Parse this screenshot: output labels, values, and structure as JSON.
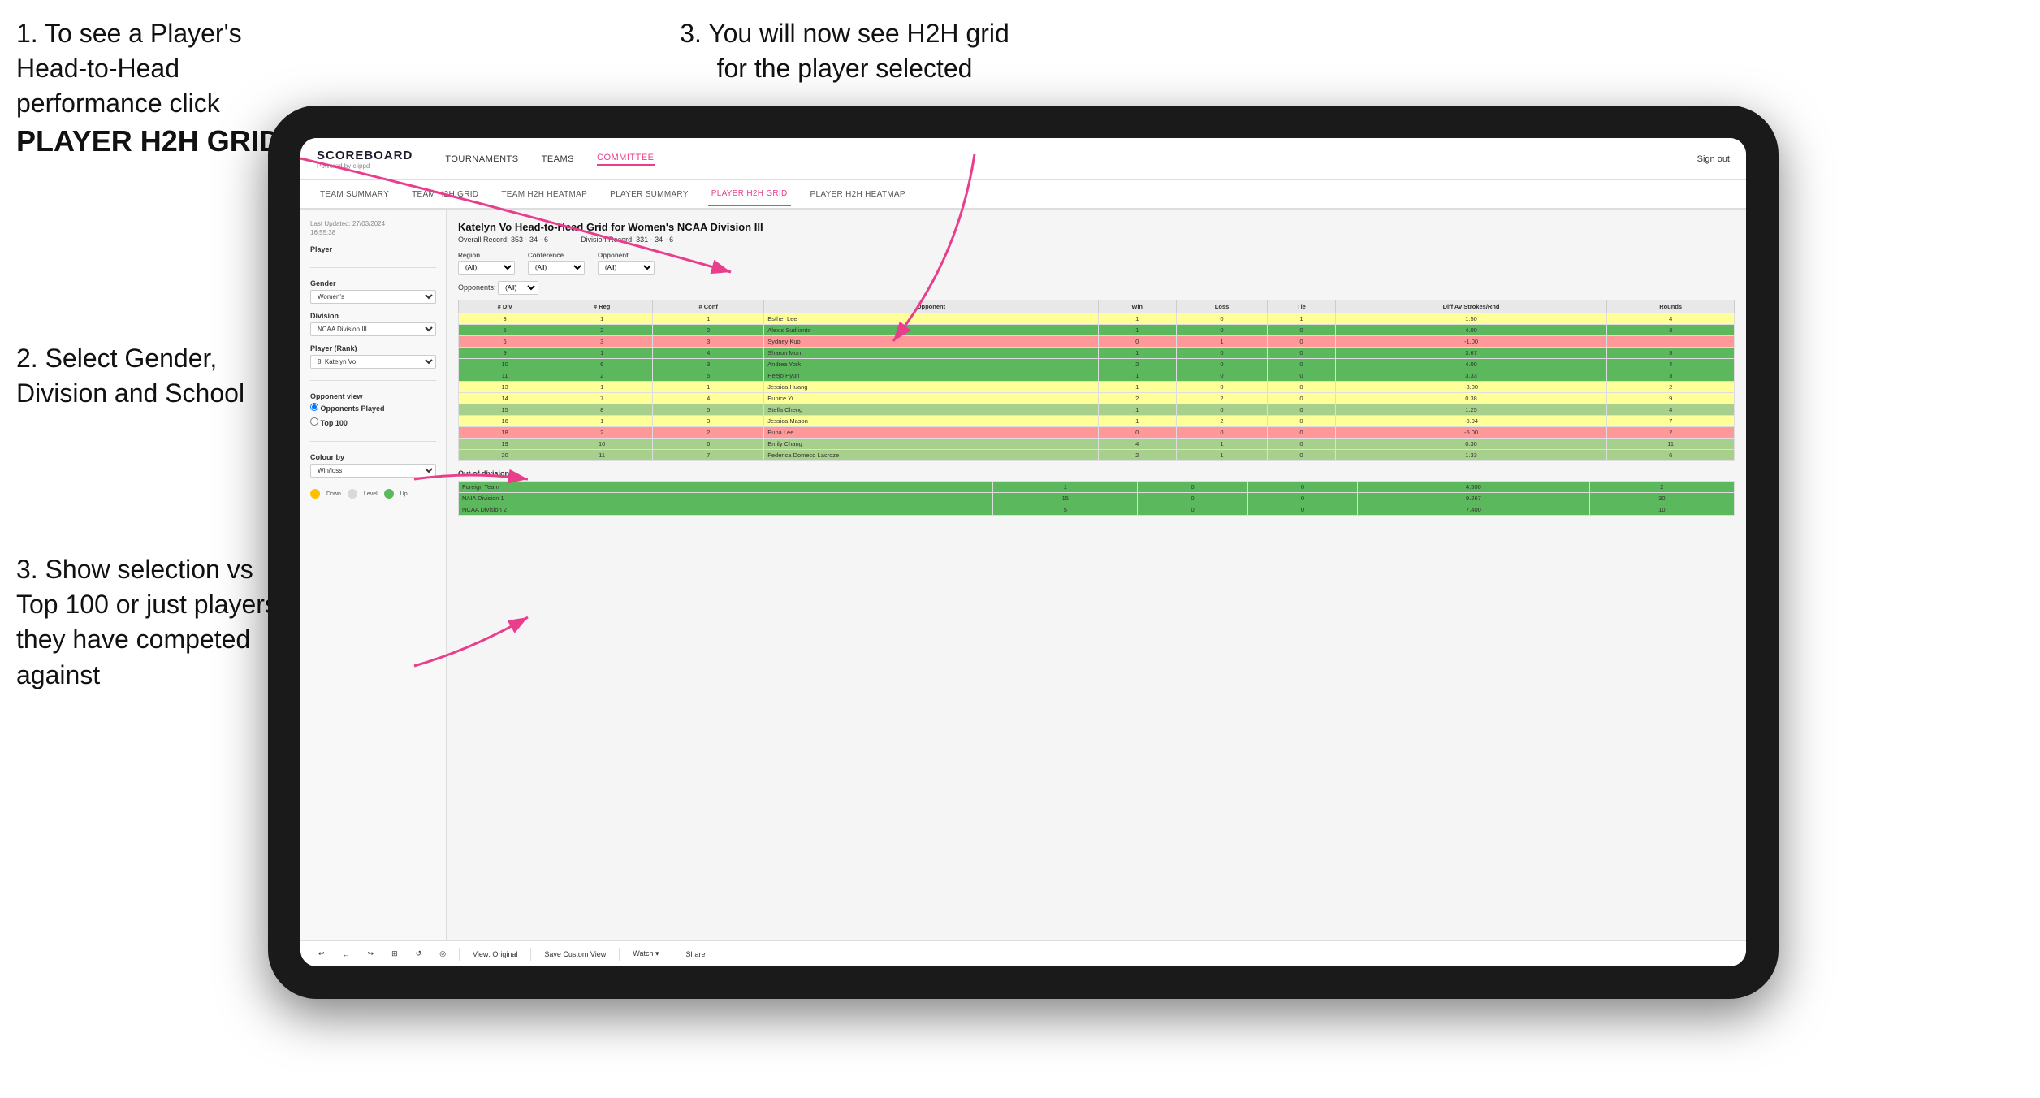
{
  "instructions": {
    "step1_title": "1. To see a Player's Head-to-Head performance click",
    "step1_bold": "PLAYER H2H GRID",
    "step2": "2. Select Gender, Division and School",
    "step3_top": "3. You will now see H2H grid for the player selected",
    "step3_bot": "3. Show selection vs Top 100 or just players they have competed against"
  },
  "navbar": {
    "logo": "SCOREBOARD",
    "logo_sub": "Powered by clippd",
    "items": [
      "TOURNAMENTS",
      "TEAMS",
      "COMMITTEE"
    ],
    "active": "COMMITTEE",
    "right": [
      "Sign out"
    ]
  },
  "subnav": {
    "items": [
      "TEAM SUMMARY",
      "TEAM H2H GRID",
      "TEAM H2H HEATMAP",
      "PLAYER SUMMARY",
      "PLAYER H2H GRID",
      "PLAYER H2H HEATMAP"
    ],
    "active": "PLAYER H2H GRID"
  },
  "sidebar": {
    "timestamp_label": "Last Updated: 27/03/2024",
    "timestamp_time": "16:55:38",
    "player_label": "Player",
    "gender_label": "Gender",
    "gender_value": "Women's",
    "division_label": "Division",
    "division_value": "NCAA Division III",
    "player_rank_label": "Player (Rank)",
    "player_rank_value": "8. Katelyn Vo",
    "opponent_view_label": "Opponent view",
    "opponent_options": [
      "Opponents Played",
      "Top 100"
    ],
    "opponent_selected": "Opponents Played",
    "colour_by_label": "Colour by",
    "colour_value": "Win/loss",
    "legend": {
      "down": "Down",
      "level": "Level",
      "up": "Up"
    }
  },
  "h2h": {
    "title": "Katelyn Vo Head-to-Head Grid for Women's NCAA Division III",
    "overall_record": "Overall Record: 353 - 34 - 6",
    "division_record": "Division Record: 331 - 34 - 6",
    "region_label": "Region",
    "conference_label": "Conference",
    "opponent_label": "Opponent",
    "opponents_row_label": "Opponents:",
    "all_filter": "(All)",
    "columns": [
      "# Div",
      "# Reg",
      "# Conf",
      "Opponent",
      "Win",
      "Loss",
      "Tie",
      "Diff Av Strokes/Rnd",
      "Rounds"
    ],
    "rows": [
      {
        "div": 3,
        "reg": 1,
        "conf": 1,
        "name": "Esther Lee",
        "win": 1,
        "loss": 0,
        "tie": 1,
        "diff": 1.5,
        "rounds": 4,
        "color": "yellow"
      },
      {
        "div": 5,
        "reg": 2,
        "conf": 2,
        "name": "Alexis Sudjianto",
        "win": 1,
        "loss": 0,
        "tie": 0,
        "diff": 4.0,
        "rounds": 3,
        "color": "green-dark"
      },
      {
        "div": 6,
        "reg": 3,
        "conf": 3,
        "name": "Sydney Kuo",
        "win": 0,
        "loss": 1,
        "tie": 0,
        "diff": -1.0,
        "rounds": "",
        "color": "red"
      },
      {
        "div": 9,
        "reg": 1,
        "conf": 4,
        "name": "Sharon Mun",
        "win": 1,
        "loss": 0,
        "tie": 0,
        "diff": 3.67,
        "rounds": 3,
        "color": "green-dark"
      },
      {
        "div": 10,
        "reg": 6,
        "conf": 3,
        "name": "Andrea York",
        "win": 2,
        "loss": 0,
        "tie": 0,
        "diff": 4.0,
        "rounds": 4,
        "color": "green-dark"
      },
      {
        "div": 11,
        "reg": 2,
        "conf": 5,
        "name": "Heejo Hyun",
        "win": 1,
        "loss": 0,
        "tie": 0,
        "diff": 3.33,
        "rounds": 3,
        "color": "green-dark"
      },
      {
        "div": 13,
        "reg": 1,
        "conf": 1,
        "name": "Jessica Huang",
        "win": 1,
        "loss": 0,
        "tie": 0,
        "diff": -3.0,
        "rounds": 2,
        "color": "yellow"
      },
      {
        "div": 14,
        "reg": 7,
        "conf": 4,
        "name": "Eunice Yi",
        "win": 2,
        "loss": 2,
        "tie": 0,
        "diff": 0.38,
        "rounds": 9,
        "color": "yellow"
      },
      {
        "div": 15,
        "reg": 8,
        "conf": 5,
        "name": "Stella Cheng",
        "win": 1,
        "loss": 0,
        "tie": 0,
        "diff": 1.25,
        "rounds": 4,
        "color": "green-light"
      },
      {
        "div": 16,
        "reg": 1,
        "conf": 3,
        "name": "Jessica Mason",
        "win": 1,
        "loss": 2,
        "tie": 0,
        "diff": -0.94,
        "rounds": 7,
        "color": "yellow"
      },
      {
        "div": 18,
        "reg": 2,
        "conf": 2,
        "name": "Euna Lee",
        "win": 0,
        "loss": 0,
        "tie": 0,
        "diff": -5.0,
        "rounds": 2,
        "color": "red"
      },
      {
        "div": 19,
        "reg": 10,
        "conf": 6,
        "name": "Emily Chang",
        "win": 4,
        "loss": 1,
        "tie": 0,
        "diff": 0.3,
        "rounds": 11,
        "color": "green-light"
      },
      {
        "div": 20,
        "reg": 11,
        "conf": 7,
        "name": "Federica Domecq Lacroze",
        "win": 2,
        "loss": 1,
        "tie": 0,
        "diff": 1.33,
        "rounds": 6,
        "color": "green-light"
      }
    ],
    "out_of_division_label": "Out of division",
    "out_rows": [
      {
        "name": "Foreign Team",
        "win": 1,
        "loss": 0,
        "tie": 0,
        "diff": 4.5,
        "rounds": 2,
        "color": "green-dark"
      },
      {
        "name": "NAIA Division 1",
        "win": 15,
        "loss": 0,
        "tie": 0,
        "diff": 9.267,
        "rounds": 30,
        "color": "green-dark"
      },
      {
        "name": "NCAA Division 2",
        "win": 5,
        "loss": 0,
        "tie": 0,
        "diff": 7.4,
        "rounds": 10,
        "color": "green-dark"
      }
    ]
  },
  "toolbar": {
    "buttons": [
      "↩",
      "←",
      "↪",
      "⊞",
      "↺",
      "◎"
    ],
    "view_label": "View: Original",
    "save_label": "Save Custom View",
    "watch_label": "Watch ▾",
    "share_label": "Share"
  }
}
